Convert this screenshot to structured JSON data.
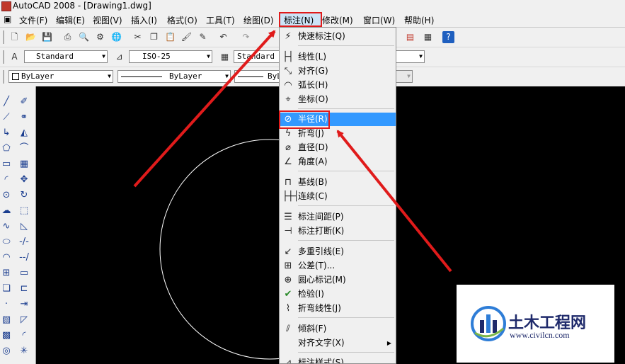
{
  "window": {
    "title": "AutoCAD 2008 - [Drawing1.dwg]"
  },
  "menubar": [
    "文件(F)",
    "编辑(E)",
    "视图(V)",
    "插入(I)",
    "格式(O)",
    "工具(T)",
    "绘图(D)",
    "标注(N)",
    "修改(M)",
    "窗口(W)",
    "帮助(H)"
  ],
  "styles_toolbar": {
    "text_style": "Standard",
    "dim_style": "ISO-25",
    "table_style": "Standard"
  },
  "properties_toolbar": {
    "color": "ByLayer",
    "linetype": "ByLayer",
    "lineweight": "ByL"
  },
  "dimension_menu": {
    "items": [
      {
        "label": "快速标注(Q)",
        "icon": "quick-dim-icon"
      },
      {
        "label": "线性(L)",
        "icon": "linear-dim-icon"
      },
      {
        "label": "对齐(G)",
        "icon": "aligned-dim-icon"
      },
      {
        "label": "弧长(H)",
        "icon": "arc-length-icon"
      },
      {
        "label": "坐标(O)",
        "icon": "ordinate-icon"
      },
      {
        "label": "半径(R)",
        "icon": "radius-icon",
        "highlighted": true
      },
      {
        "label": "折弯(J)",
        "icon": "jogged-icon"
      },
      {
        "label": "直径(D)",
        "icon": "diameter-icon"
      },
      {
        "label": "角度(A)",
        "icon": "angular-icon"
      },
      {
        "label": "基线(B)",
        "icon": "baseline-icon"
      },
      {
        "label": "连续(C)",
        "icon": "continue-icon"
      },
      {
        "label": "标注间距(P)",
        "icon": "dim-space-icon"
      },
      {
        "label": "标注打断(K)",
        "icon": "dim-break-icon"
      },
      {
        "label": "多重引线(E)",
        "icon": "multileader-icon"
      },
      {
        "label": "公差(T)...",
        "icon": "tolerance-icon"
      },
      {
        "label": "圆心标记(M)",
        "icon": "center-mark-icon"
      },
      {
        "label": "检验(I)",
        "icon": "inspect-icon"
      },
      {
        "label": "折弯线性(J)",
        "icon": "jogged-linear-icon"
      },
      {
        "label": "倾斜(F)",
        "icon": "oblique-icon"
      },
      {
        "label": "对齐文字(X)",
        "icon": "",
        "submenu": true
      },
      {
        "label": "标注样式(S)...",
        "icon": "dim-style-icon"
      }
    ]
  },
  "watermark": {
    "site_name": "土木工程网",
    "url": "www.civilcn.com"
  },
  "colors": {
    "highlight": "#3399ff",
    "annotation_red": "#e01b1b",
    "canvas": "#000000",
    "circle": "#ffffff"
  }
}
